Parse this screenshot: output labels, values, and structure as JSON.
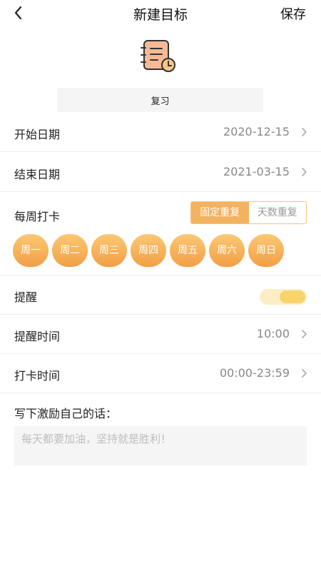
{
  "header": {
    "title": "新建目标",
    "save_label": "保存",
    "back_icon": "chevron-left-icon"
  },
  "goal": {
    "icon": "notebook-clock-icon",
    "name": "复习"
  },
  "rows": {
    "start_date": {
      "label": "开始日期",
      "value": "2020-12-15"
    },
    "end_date": {
      "label": "结束日期",
      "value": "2021-03-15"
    },
    "weekly": {
      "label": "每周打卡",
      "modes": [
        {
          "label": "固定重复",
          "active": true
        },
        {
          "label": "天数重复",
          "active": false
        }
      ],
      "days": [
        "周一",
        "周二",
        "周三",
        "周四",
        "周五",
        "周六",
        "周日"
      ]
    },
    "reminder": {
      "label": "提醒",
      "enabled": true
    },
    "reminder_time": {
      "label": "提醒时间",
      "value": "10:00"
    },
    "checkin_time": {
      "label": "打卡时间",
      "value": "00:00-23:59"
    }
  },
  "motto": {
    "label": "写下激励自己的话：",
    "placeholder": "每天都要加油，坚持就是胜利！",
    "value": ""
  },
  "colors": {
    "accent": "#f3b25f",
    "toggle_track": "#fbeec7",
    "toggle_knob": "#f9d46a",
    "day_gradient_top": "#fbc874",
    "day_gradient_bottom": "#f29f46"
  }
}
